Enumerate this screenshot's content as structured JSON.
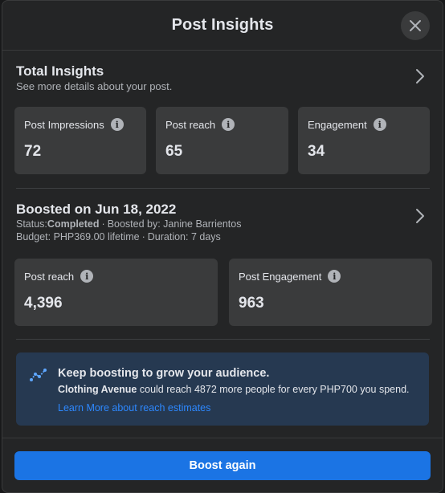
{
  "header": {
    "title": "Post Insights"
  },
  "total": {
    "title": "Total Insights",
    "subtitle": "See more details about your post.",
    "cards": [
      {
        "label": "Post Impressions",
        "value": "72"
      },
      {
        "label": "Post reach",
        "value": "65"
      },
      {
        "label": "Engagement",
        "value": "34"
      }
    ]
  },
  "boosted": {
    "title": "Boosted on Jun 18, 2022",
    "status_label": "Status:",
    "status_value": "Completed",
    "sep": "·",
    "boosted_by": "Boosted by: Janine Barrientos",
    "budget": "Budget: PHP369.00 lifetime",
    "duration": "Duration: 7 days",
    "cards": [
      {
        "label": "Post reach",
        "value": "4,396"
      },
      {
        "label": "Post Engagement",
        "value": "963"
      }
    ]
  },
  "tip": {
    "title": "Keep boosting to grow your audience.",
    "page_name": "Clothing Avenue",
    "text": " could reach 4872 more people for every PHP700 you spend.",
    "link": "Learn More about reach estimates"
  },
  "footer": {
    "boost_label": "Boost again"
  },
  "info_glyph": "i",
  "colors": {
    "accent": "#1b74e4",
    "link": "#2d88ff",
    "tip_bg": "#263951",
    "card_bg": "#3a3b3c"
  }
}
